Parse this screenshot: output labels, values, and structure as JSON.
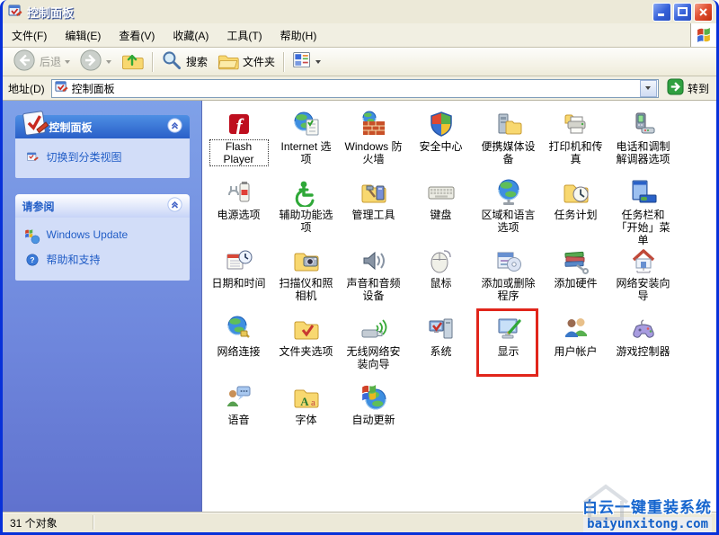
{
  "window": {
    "title": "控制面板"
  },
  "menu_bar": {
    "items": [
      "文件(F)",
      "编辑(E)",
      "查看(V)",
      "收藏(A)",
      "工具(T)",
      "帮助(H)"
    ]
  },
  "toolbar": {
    "back_label": "后退",
    "search_label": "搜索",
    "folders_label": "文件夹"
  },
  "address_bar": {
    "label": "地址(D)",
    "value": "控制面板",
    "go_label": "转到"
  },
  "sidebar": {
    "panel1": {
      "title": "控制面板",
      "items": [
        {
          "label": "切换到分类视图",
          "icon": "category-view"
        }
      ]
    },
    "panel2": {
      "title": "请参阅",
      "items": [
        {
          "label": "Windows Update",
          "icon": "windows-update"
        },
        {
          "label": "帮助和支持",
          "icon": "help"
        }
      ]
    }
  },
  "icons": [
    {
      "label": "Flash Player",
      "icon": "flash-player",
      "selected": true
    },
    {
      "label": "Internet 选项",
      "icon": "internet-options"
    },
    {
      "label": "Windows 防火墙",
      "icon": "windows-firewall"
    },
    {
      "label": "安全中心",
      "icon": "security-center"
    },
    {
      "label": "便携媒体设备",
      "icon": "portable-media"
    },
    {
      "label": "打印机和传真",
      "icon": "printers-faxes"
    },
    {
      "label": "电话和调制解调器选项",
      "icon": "phone-modem"
    },
    {
      "label": "电源选项",
      "icon": "power-options"
    },
    {
      "label": "辅助功能选项",
      "icon": "accessibility"
    },
    {
      "label": "管理工具",
      "icon": "admin-tools"
    },
    {
      "label": "键盘",
      "icon": "keyboard"
    },
    {
      "label": "区域和语言选项",
      "icon": "regional-language"
    },
    {
      "label": "任务计划",
      "icon": "scheduled-tasks"
    },
    {
      "label": "任务栏和「开始」菜单",
      "icon": "taskbar-start"
    },
    {
      "label": "日期和时间",
      "icon": "date-time"
    },
    {
      "label": "扫描仪和照相机",
      "icon": "scanners-cameras"
    },
    {
      "label": "声音和音频设备",
      "icon": "sounds-audio"
    },
    {
      "label": "鼠标",
      "icon": "mouse"
    },
    {
      "label": "添加或删除程序",
      "icon": "add-remove-programs"
    },
    {
      "label": "添加硬件",
      "icon": "add-hardware"
    },
    {
      "label": "网络安装向导",
      "icon": "network-setup-wizard"
    },
    {
      "label": "网络连接",
      "icon": "network-connections"
    },
    {
      "label": "文件夹选项",
      "icon": "folder-options"
    },
    {
      "label": "无线网络安装向导",
      "icon": "wireless-wizard"
    },
    {
      "label": "系统",
      "icon": "system"
    },
    {
      "label": "显示",
      "icon": "display",
      "highlighted": true
    },
    {
      "label": "用户帐户",
      "icon": "user-accounts"
    },
    {
      "label": "游戏控制器",
      "icon": "game-controllers"
    },
    {
      "label": "语音",
      "icon": "speech"
    },
    {
      "label": "字体",
      "icon": "fonts"
    },
    {
      "label": "自动更新",
      "icon": "auto-update"
    }
  ],
  "status_bar": {
    "text": "31 个对象"
  },
  "watermark": {
    "line1": "白云一键重装系统",
    "line2": "baiyunxitong.com"
  },
  "colors": {
    "highlight_box": "#E1251B",
    "sidebar_blue": "#6E86DC",
    "link_blue": "#215DC6",
    "watermark_blue": "#1565CE"
  }
}
